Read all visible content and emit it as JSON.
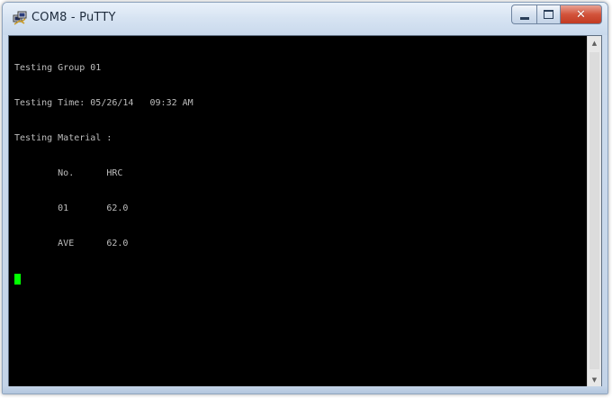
{
  "window": {
    "title": "COM8 - PuTTY",
    "icon": "putty-icon",
    "buttons": {
      "minimize": "minimize-icon",
      "maximize": "maximize-icon",
      "close": "close-icon"
    }
  },
  "terminal": {
    "lines": [
      "Testing Group 01",
      "Testing Time: 05/26/14   09:32 AM",
      "Testing Material :",
      "        No.      HRC",
      "        01       62.0",
      "        AVE      62.0"
    ],
    "cursor_color": "#00ff00",
    "text_color": "#bdbdbd",
    "background_color": "#000000"
  },
  "scrollbar": {
    "up_icon": "scroll-up-icon",
    "down_icon": "scroll-down-icon"
  }
}
